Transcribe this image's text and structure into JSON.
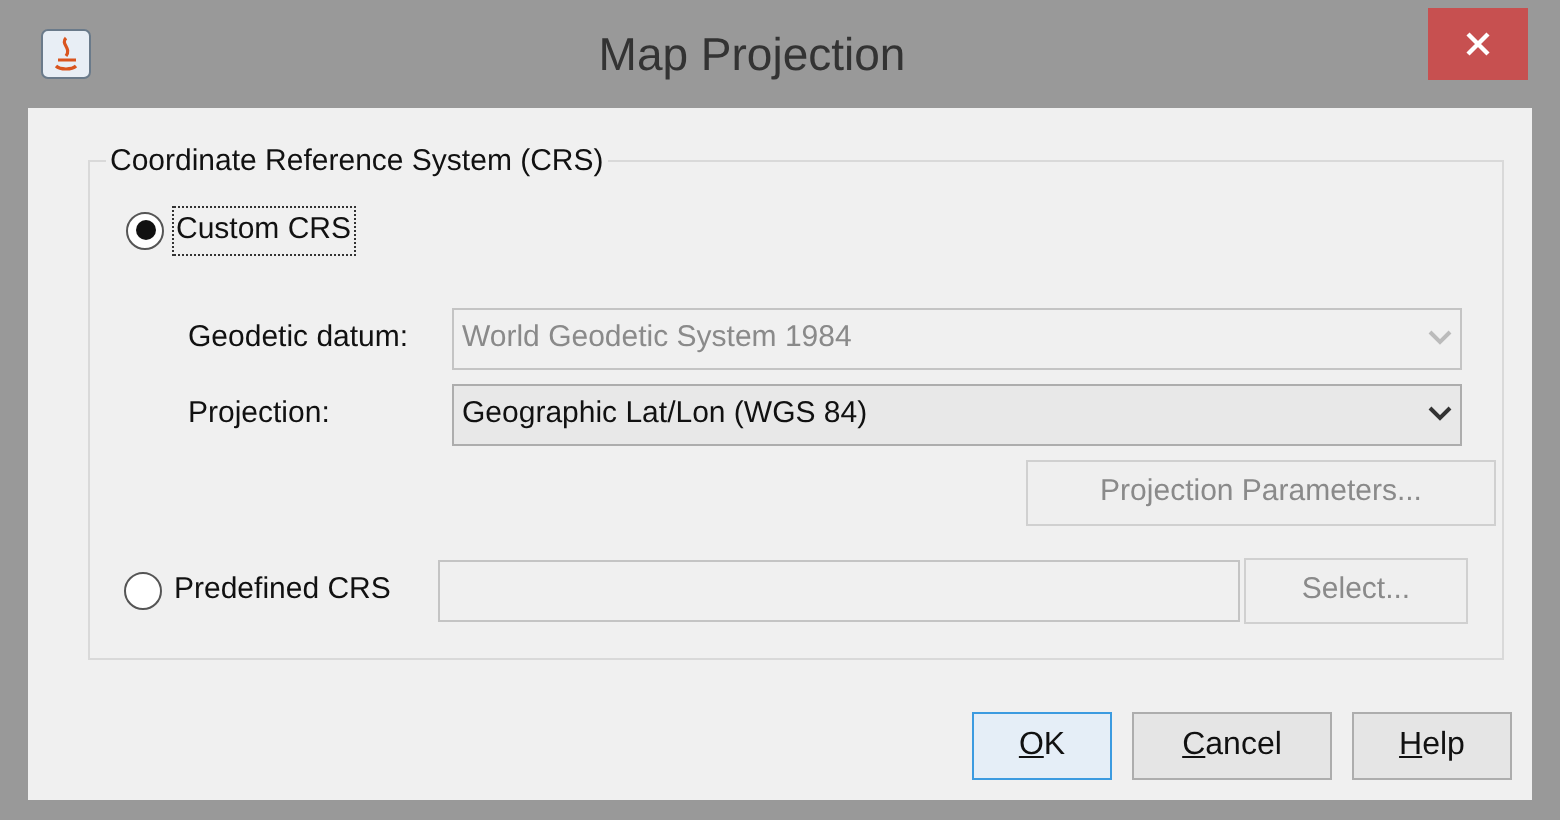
{
  "window": {
    "title": "Map Projection"
  },
  "group": {
    "title": "Coordinate Reference System (CRS)"
  },
  "custom": {
    "label": "Custom CRS",
    "selected": true,
    "focused": true
  },
  "datum": {
    "label": "Geodetic datum:",
    "value": "World Geodetic System 1984",
    "disabled": true
  },
  "projection": {
    "label": "Projection:",
    "value": "Geographic Lat/Lon (WGS 84)",
    "disabled": false
  },
  "params_button": {
    "label": "Projection Parameters...",
    "disabled": true
  },
  "predefined": {
    "label": "Predefined CRS",
    "selected": false,
    "focused": false
  },
  "predefined_field": {
    "disabled": true
  },
  "select_button": {
    "label": "Select...",
    "disabled": true
  },
  "buttons": [
    {
      "label": "OK",
      "underline_first": true,
      "default": true
    },
    {
      "label": "Cancel",
      "underline_first": true,
      "default": false
    },
    {
      "label": "Help",
      "underline_first": true,
      "default": false
    }
  ]
}
